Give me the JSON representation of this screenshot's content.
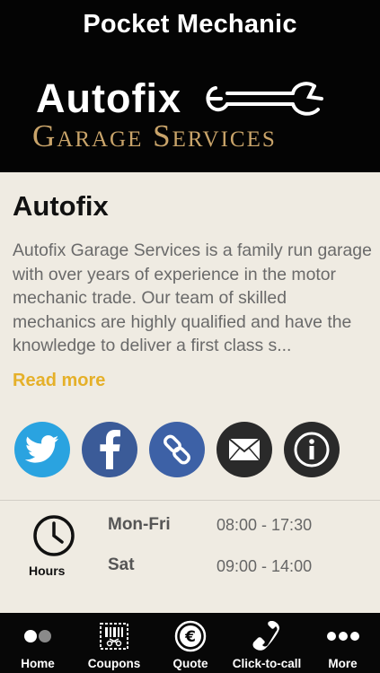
{
  "header": {
    "app_title": "Pocket Mechanic",
    "logo": {
      "word": "Autofix",
      "subtitle": "Garage Services"
    }
  },
  "business": {
    "name": "Autofix",
    "description": "Autofix Garage Services is a family run garage with over years of experience in the motor mechanic trade.  Our team of skilled mechanics are highly qualified and have the knowledge to deliver a first class s...",
    "read_more_label": "Read more"
  },
  "social": [
    {
      "name": "twitter",
      "icon": "twitter-bird-icon",
      "color": "#2aa3e0"
    },
    {
      "name": "facebook",
      "icon": "facebook-f-icon",
      "color": "#3b5b98"
    },
    {
      "name": "website",
      "icon": "link-icon",
      "color": "#3d61a6"
    },
    {
      "name": "email",
      "icon": "envelope-icon",
      "color": "#2a2a2a"
    },
    {
      "name": "info",
      "icon": "info-icon",
      "color": "#2a2a2a"
    }
  ],
  "hours": {
    "label": "Hours",
    "rows": [
      {
        "day": "Mon-Fri",
        "time": "08:00 - 17:30"
      },
      {
        "day": "Sat",
        "time": "09:00 - 14:00"
      }
    ]
  },
  "tabbar": {
    "items": [
      {
        "label": "Home",
        "icon": "dots-icon"
      },
      {
        "label": "Coupons",
        "icon": "coupon-scissors-icon"
      },
      {
        "label": "Quote",
        "icon": "euro-coin-icon"
      },
      {
        "label": "Click-to-call",
        "icon": "phone-icon"
      },
      {
        "label": "More",
        "icon": "more-dots-icon"
      }
    ]
  },
  "colors": {
    "header_bg": "#040404",
    "page_bg": "#efebe2",
    "accent": "#e5b029",
    "logo_gold": "#c9a46a"
  }
}
